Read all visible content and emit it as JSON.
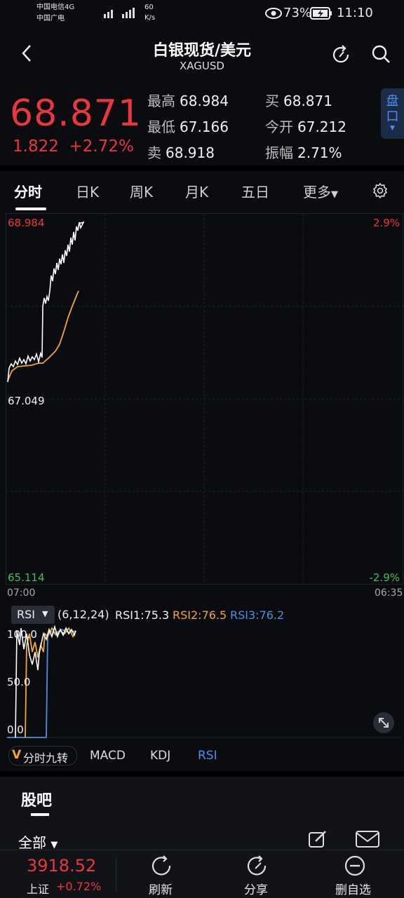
{
  "status_bar": {
    "carrier1": "中国电信4G",
    "carrier2": "中国广电",
    "net_speed": "60",
    "net_unit": "K/s",
    "battery": "73%",
    "time": "11:10"
  },
  "header": {
    "title": "白银现货/美元",
    "subtitle": "XAGUSD"
  },
  "quote": {
    "price": "68.871",
    "change": "1.822",
    "change_pct": "+2.72%",
    "high_label": "最高",
    "high": "68.984",
    "low_label": "最低",
    "low": "67.166",
    "sell_label": "卖",
    "sell": "68.918",
    "buy_label": "买",
    "buy": "68.871",
    "open_label": "今开",
    "open": "67.212",
    "amp_label": "振幅",
    "amp": "2.71%",
    "pankou": "盘口"
  },
  "tabs": [
    "分时",
    "日K",
    "周K",
    "月K",
    "五日",
    "更多"
  ],
  "chart_labels": {
    "top_price": "68.984",
    "mid_price": "67.049",
    "bottom_price": "65.114",
    "top_pct": "2.9%",
    "bottom_pct": "-2.9%",
    "start_time": "07:00",
    "end_time": "06:35"
  },
  "rsi": {
    "selector": "RSI",
    "params": "(6,12,24)",
    "rsi1": "RSI1:75.3",
    "rsi2": "RSI2:76.5",
    "rsi3": "RSI3:76.2",
    "y100": "100.0",
    "y50": "50.0",
    "y0": "0.0"
  },
  "indicator_tabs": {
    "nine": "分时九转",
    "macd": "MACD",
    "kdj": "KDJ",
    "rsi": "RSI"
  },
  "community": {
    "title": "股吧",
    "filter": "全部"
  },
  "bottom_bar": {
    "index_value": "3918.52",
    "index_name": "上证",
    "index_change": "+0.72%",
    "refresh": "刷新",
    "share": "分享",
    "remove": "删自选"
  },
  "colors": {
    "up": "#e8383d",
    "down": "#3fbf5f",
    "price_line": "#ffffff",
    "avg_line": "#f0a830",
    "rsi_blue": "#4a90e2",
    "accent": "#4f8ff0"
  }
}
